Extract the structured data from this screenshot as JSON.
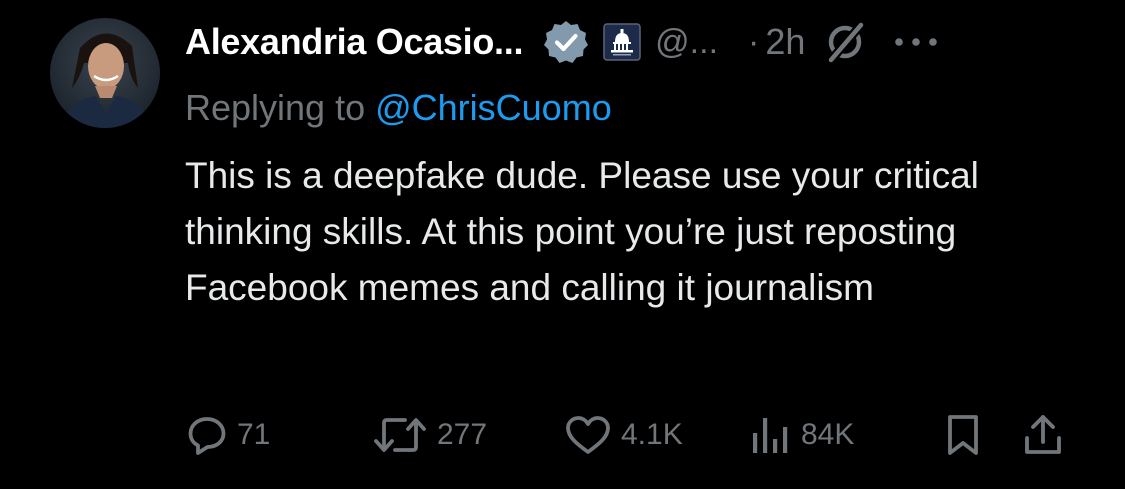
{
  "tweet": {
    "author_name": "Alexandria Ocasio...",
    "handle": "@...",
    "separator": "·",
    "time": "2h",
    "replying_prefix": "Replying to ",
    "replying_to": "@ChrisCuomo",
    "text": "This is a deepfake dude. Please use your critical thinking skills. At this point you’re just reposting Facebook memes and calling it journalism"
  },
  "badges": {
    "verified_color": "#829aab",
    "government_color": "#1e2a4a"
  },
  "icons": {
    "edited": "edit-slash-icon",
    "more": "more-dots-icon",
    "reply": "reply-bubble-icon",
    "repost": "repost-arrows-icon",
    "like": "heart-icon",
    "views": "views-bars-icon",
    "bookmark": "bookmark-icon",
    "share": "share-upload-icon"
  },
  "actions": {
    "replies": "71",
    "reposts": "277",
    "likes": "4.1K",
    "views": "84K"
  },
  "colors": {
    "background": "#000000",
    "text": "#e7e9ea",
    "muted": "#71767b",
    "link": "#1d9bf0"
  }
}
